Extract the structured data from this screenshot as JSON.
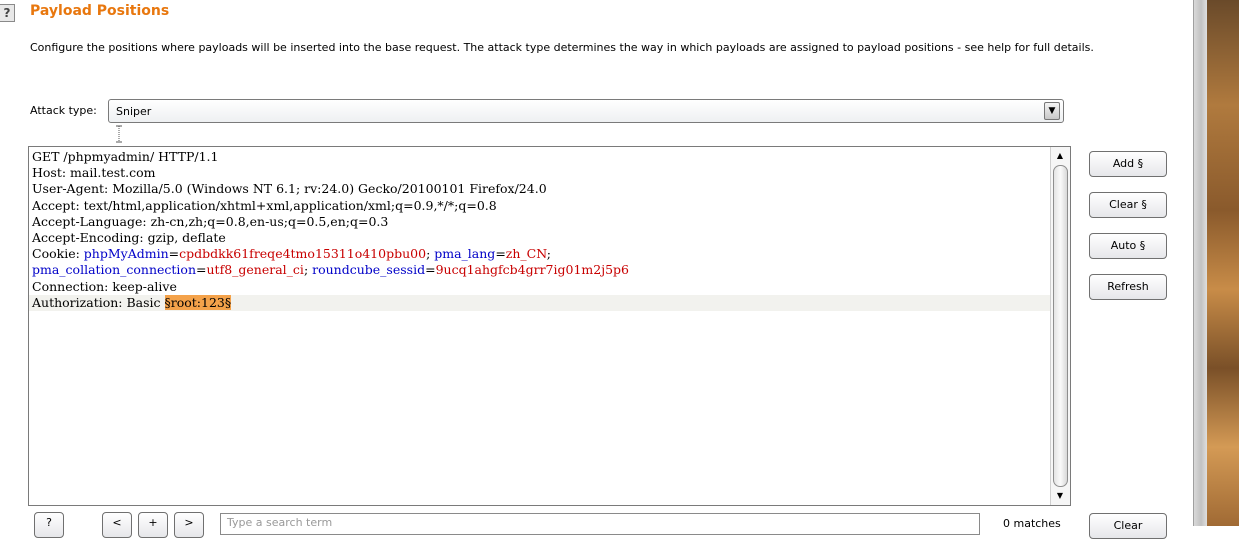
{
  "section": {
    "help_icon": "?",
    "title": "Payload Positions",
    "description": "Configure the positions where payloads will be inserted into the base request. The attack type determines the way in which payloads are assigned to payload positions - see help for full details."
  },
  "attack": {
    "label": "Attack type:",
    "selected": "Sniper",
    "arrow": "▼"
  },
  "request_lines": [
    [
      {
        "t": "GET /phpmyadmin/ HTTP/1.1"
      }
    ],
    [
      {
        "t": "Host: mail.test.com"
      }
    ],
    [
      {
        "t": "User-Agent: Mozilla/5.0 (Windows NT 6.1; rv:24.0) Gecko/20100101 Firefox/24.0"
      }
    ],
    [
      {
        "t": "Accept: text/html,application/xhtml+xml,application/xml;q=0.9,*/*;q=0.8"
      }
    ],
    [
      {
        "t": "Accept-Language: zh-cn,zh;q=0.8,en-us;q=0.5,en;q=0.3"
      }
    ],
    [
      {
        "t": "Accept-Encoding: gzip, deflate"
      }
    ],
    [
      {
        "t": "Cookie: "
      },
      {
        "t": "phpMyAdmin",
        "c": "k"
      },
      {
        "t": "="
      },
      {
        "t": "cpdbdkk61freqe4tmo15311o410pbu00",
        "c": "v"
      },
      {
        "t": "; "
      },
      {
        "t": "pma_lang",
        "c": "k"
      },
      {
        "t": "="
      },
      {
        "t": "zh_CN",
        "c": "v"
      },
      {
        "t": ";"
      }
    ],
    [
      {
        "t": "pma_collation_connection",
        "c": "k"
      },
      {
        "t": "="
      },
      {
        "t": "utf8_general_ci",
        "c": "v"
      },
      {
        "t": "; "
      },
      {
        "t": "roundcube_sessid",
        "c": "k"
      },
      {
        "t": "="
      },
      {
        "t": "9ucq1ahgfcb4grr7ig01m2j5p6",
        "c": "v"
      }
    ],
    [
      {
        "t": "Connection: keep-alive"
      }
    ],
    [
      {
        "t": "Authorization: Basic "
      },
      {
        "t": "§root:123§",
        "c": "marker"
      }
    ]
  ],
  "current_line_index": 9,
  "side_buttons": {
    "add": "Add §",
    "clear": "Clear §",
    "auto": "Auto §",
    "refresh": "Refresh"
  },
  "bottom": {
    "help": "?",
    "prev": "<",
    "add": "+",
    "next": ">",
    "search_placeholder": "Type a search term",
    "matches": "0 matches",
    "clear": "Clear"
  },
  "colors": {
    "title": "#e8770e",
    "param_name": "#0000c8",
    "param_value": "#c80000",
    "marker_bg": "#f4a24a"
  },
  "icons": {
    "scroll_up": "▲",
    "scroll_down": "▼"
  }
}
